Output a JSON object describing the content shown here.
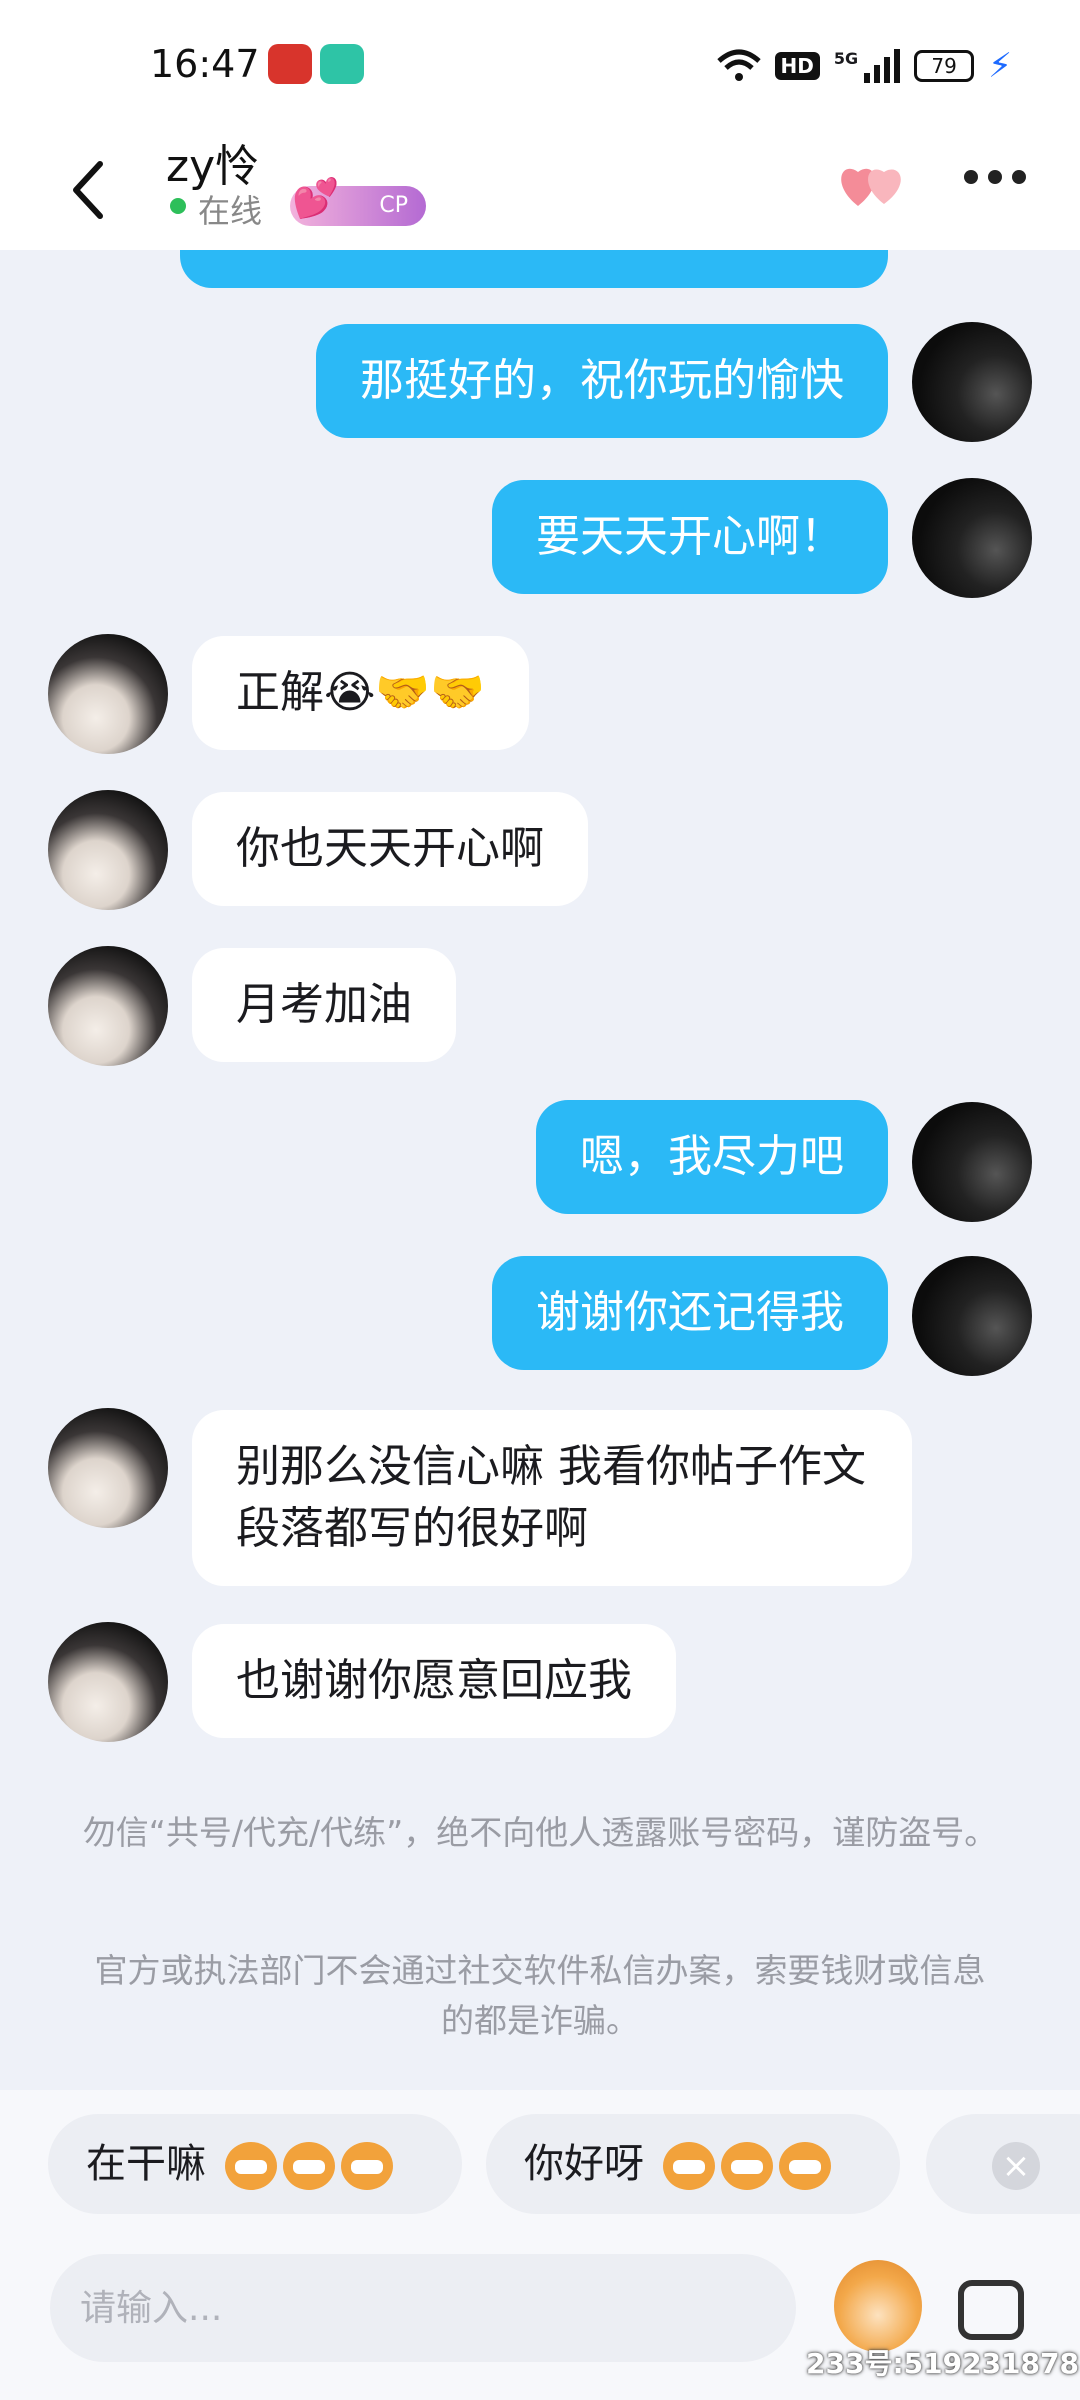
{
  "status_bar": {
    "time": "16:47",
    "hd": "HD",
    "signal": "5G",
    "battery": "79"
  },
  "header": {
    "contact_name": "zy怜",
    "status": "在线",
    "cp_label": "CP",
    "accent_color": "#2bb9f6"
  },
  "messages": [
    {
      "from": "me",
      "text": "那挺好的，祝你玩的愉快"
    },
    {
      "from": "me",
      "text": "要天天开心啊！"
    },
    {
      "from": "them",
      "text": "正解😭🤝🤝"
    },
    {
      "from": "them",
      "text": "你也天天开心啊"
    },
    {
      "from": "them",
      "text": "月考加油"
    },
    {
      "from": "me",
      "text": "嗯，我尽力吧"
    },
    {
      "from": "me",
      "text": "谢谢你还记得我"
    },
    {
      "from": "them",
      "text": "别那么没信心嘛 我看你帖子作文段落都写的很好啊"
    },
    {
      "from": "them",
      "text": "也谢谢你愿意回应我"
    }
  ],
  "notices": [
    "勿信“共号/代充/代练”，绝不向他人透露账号密码，谨防盗号。",
    "官方或执法部门不会通过社交软件私信办案，索要钱财或信息的都是诈骗。"
  ],
  "quick_replies": [
    {
      "label": "在干嘛"
    },
    {
      "label": "你好呀"
    }
  ],
  "input": {
    "placeholder": "请输入..."
  },
  "watermark": "233号:519231878"
}
